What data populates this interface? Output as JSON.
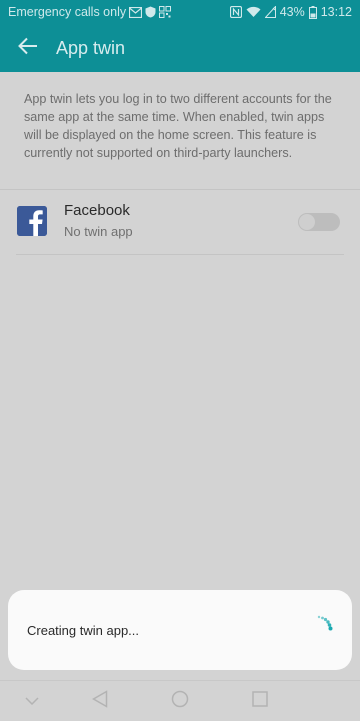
{
  "status_bar": {
    "carrier": "Emergency calls only",
    "battery": "43%",
    "time": "13:12",
    "icons": [
      "mail-icon",
      "shield-icon",
      "qr-icon",
      "nfc-icon",
      "wifi-icon",
      "signal-icon",
      "battery-icon"
    ]
  },
  "header": {
    "title": "App twin",
    "back_icon": "back-arrow-icon"
  },
  "description": "App twin lets you log in to two different accounts for the same app at the same time. When enabled, twin apps will be displayed on the home screen. This feature is currently not supported on third-party launchers.",
  "apps": [
    {
      "name": "Facebook",
      "status": "No twin app",
      "icon": "facebook-icon",
      "toggle_on": false
    }
  ],
  "dialog": {
    "message": "Creating twin app...",
    "spinner_icon": "loading-spinner-icon"
  },
  "nav": {
    "items": [
      "collapse-icon",
      "back-icon",
      "home-icon",
      "recents-icon"
    ]
  },
  "colors": {
    "accent": "#0d8f96",
    "background": "#d3d3d3",
    "spinner": "#1aa9b0"
  }
}
